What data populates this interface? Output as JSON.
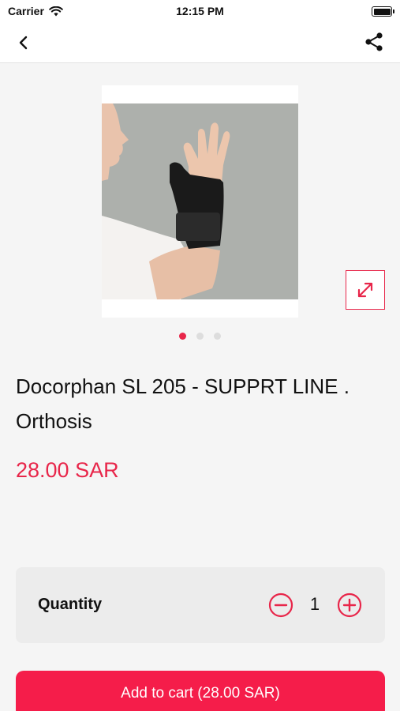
{
  "status_bar": {
    "carrier": "Carrier",
    "time": "12:15 PM"
  },
  "nav": {
    "back_icon": "chevron-left-icon",
    "share_icon": "share-icon"
  },
  "product": {
    "title": "Docorphan SL 205 - SUPPRT LINE . Orthosis",
    "price": "28.00 SAR",
    "image_alt": "thumb-wrist-brace-photo",
    "carousel": {
      "count": 3,
      "active_index": 0
    }
  },
  "quantity": {
    "label": "Quantity",
    "value": "1"
  },
  "cart": {
    "button_label": "Add to cart (28.00 SAR)"
  },
  "colors": {
    "accent": "#e8264a",
    "button": "#f51d4a",
    "background": "#f5f5f5",
    "card": "#ececec"
  }
}
